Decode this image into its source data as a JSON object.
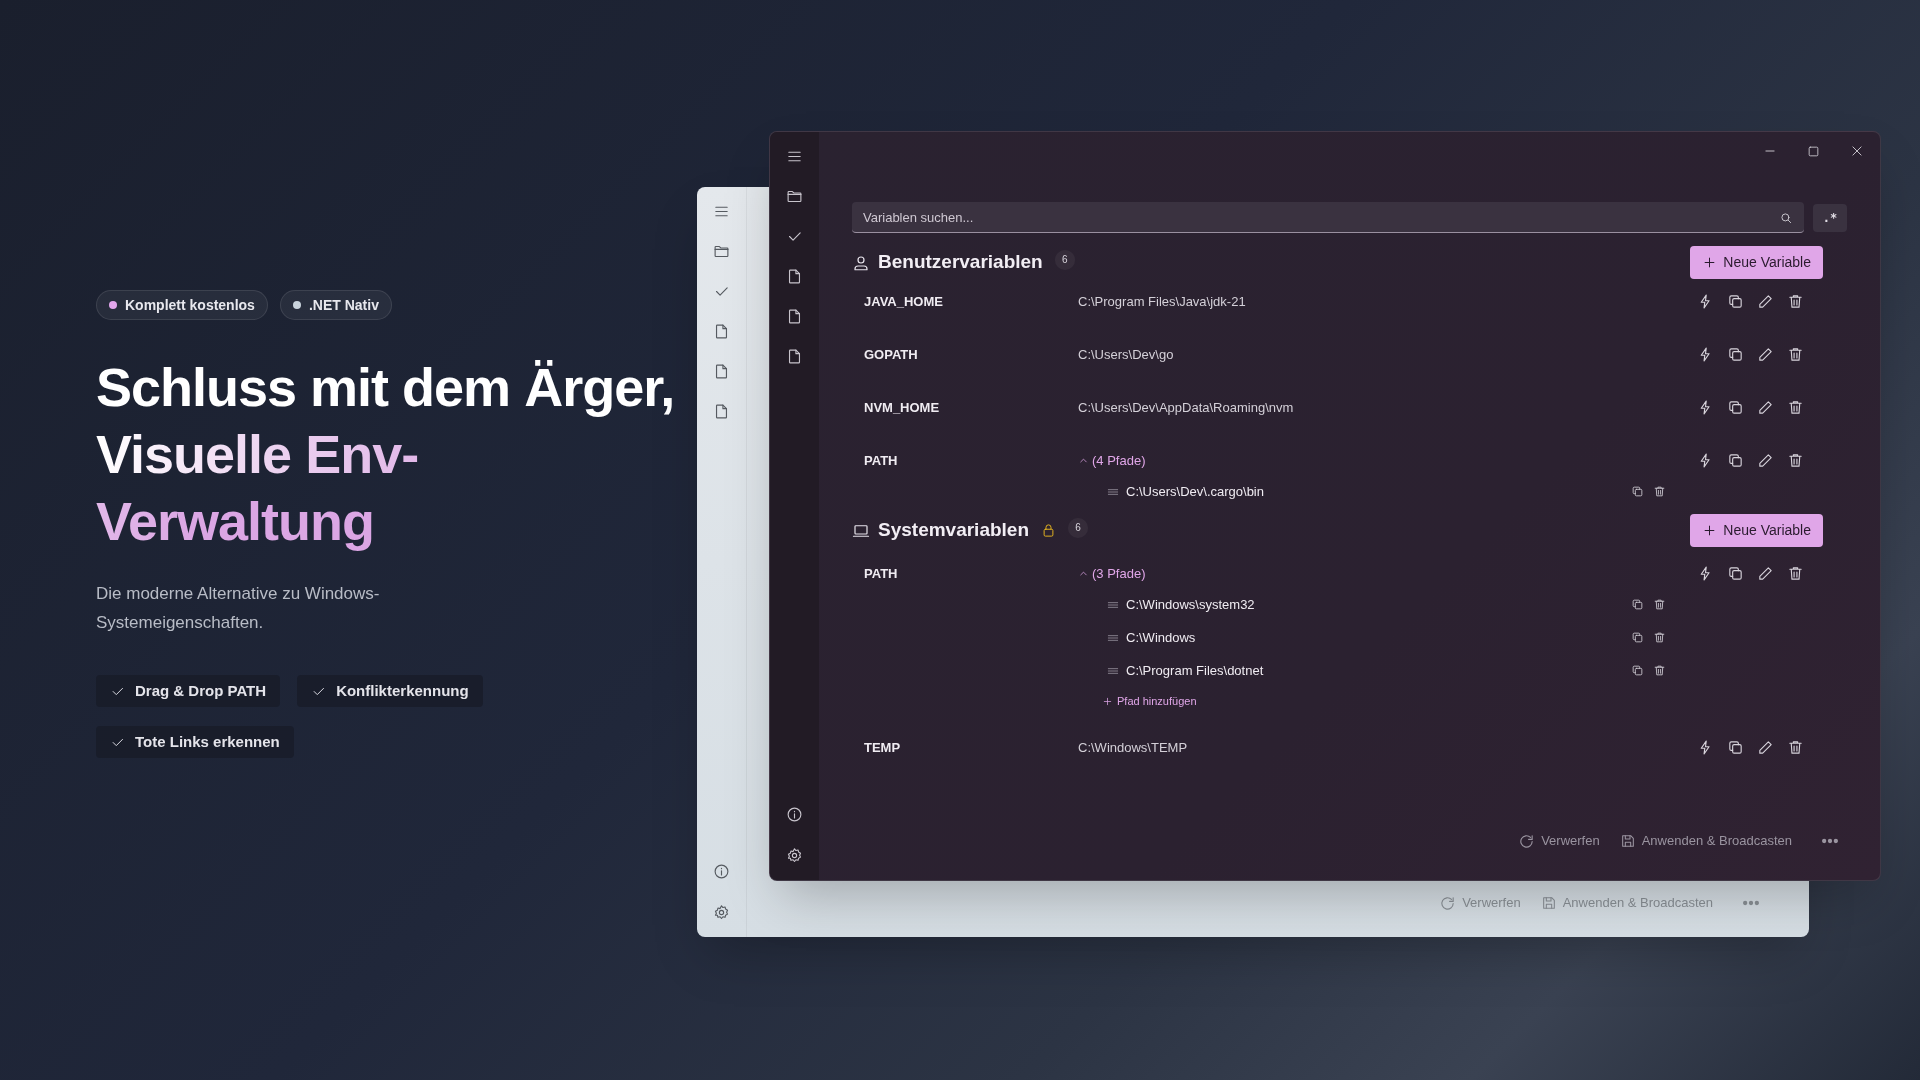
{
  "badges": [
    {
      "label": "Komplett kostenlos",
      "color": "#e2a6ec"
    },
    {
      "label": ".NET Nativ",
      "color": "#c9d3dc"
    }
  ],
  "heading": {
    "text": "Schluss mit dem Ärger,",
    "highlight": "Visuelle Env-Verwaltung"
  },
  "subtitle": "Die moderne Alternative zu Windows-Systemeigenschaften.",
  "features": [
    "Drag & Drop PATH",
    "Konflikterkennung",
    "Tote Links erkennen"
  ],
  "back_window": {
    "footer": {
      "discard": "Verwerfen",
      "apply": "Anwenden & Broadcasten"
    }
  },
  "window": {
    "search": {
      "placeholder": "Variablen suchen..."
    },
    "regex_button": ".*",
    "sections": [
      {
        "kind": "user",
        "title": "Benutzervariablen",
        "count": "6",
        "locked": false,
        "new_button": "Neue Variable",
        "variables": [
          {
            "name": "JAVA_HOME",
            "value": "C:\\Program Files\\Java\\jdk-21"
          },
          {
            "name": "GOPATH",
            "value": "C:\\Users\\Dev\\go"
          },
          {
            "name": "NVM_HOME",
            "value": "C:\\Users\\Dev\\AppData\\Roaming\\nvm"
          },
          {
            "name": "PATH",
            "summary": "(4 Pfade)",
            "expanded": true,
            "paths": [
              "C:\\Users\\Dev\\.cargo\\bin"
            ]
          }
        ]
      },
      {
        "kind": "system",
        "title": "Systemvariablen",
        "count": "6",
        "locked": true,
        "new_button": "Neue Variable",
        "variables": [
          {
            "name": "PATH",
            "summary": "(3 Pfade)",
            "expanded": true,
            "paths": [
              "C:\\Windows\\system32",
              "C:\\Windows",
              "C:\\Program Files\\dotnet"
            ],
            "add_path": "Pfad hinzufügen"
          },
          {
            "name": "TEMP",
            "value": "C:\\Windows\\TEMP"
          }
        ]
      }
    ],
    "footer": {
      "discard": "Verwerfen",
      "apply": "Anwenden & Broadcasten"
    }
  }
}
